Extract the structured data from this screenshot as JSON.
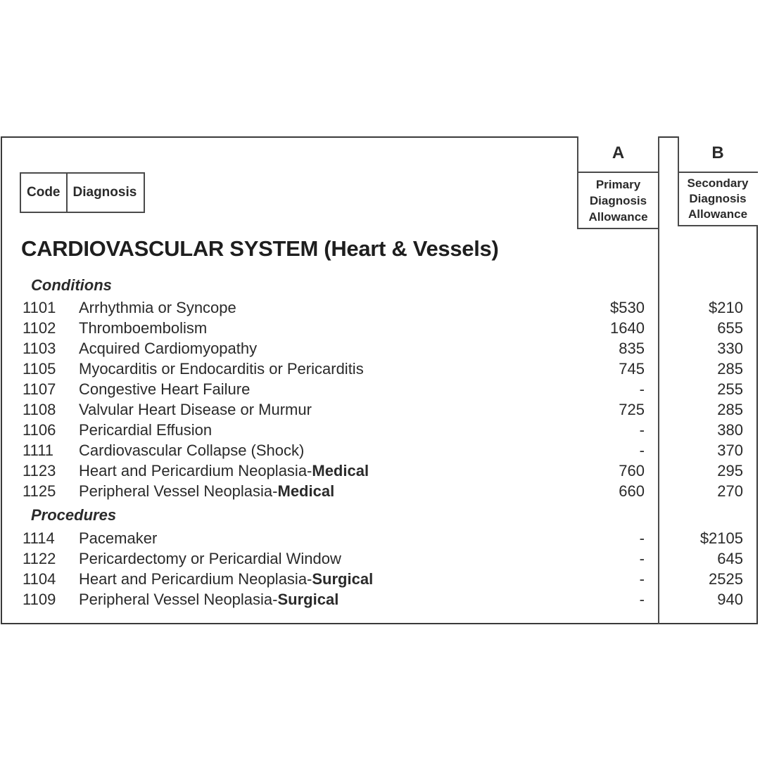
{
  "columns": {
    "code_label": "Code",
    "diagnosis_label": "Diagnosis",
    "a": {
      "letter": "A",
      "lines": [
        "Primary",
        "Diagnosis",
        "Allowance"
      ]
    },
    "b": {
      "letter": "B",
      "lines": [
        "Secondary",
        "Diagnosis",
        "Allowance"
      ]
    }
  },
  "section_title": "CARDIOVASCULAR SYSTEM (Heart & Vessels)",
  "groups": [
    {
      "heading": "Conditions",
      "rows": [
        {
          "code": "1101",
          "diagnosis": "Arrhythmia or Syncope",
          "suffix": "",
          "a": "$530",
          "b": "$210"
        },
        {
          "code": "1102",
          "diagnosis": "Thromboembolism",
          "suffix": "",
          "a": "1640",
          "b": "655"
        },
        {
          "code": "1103",
          "diagnosis": "Acquired Cardiomyopathy",
          "suffix": "",
          "a": "835",
          "b": "330"
        },
        {
          "code": "1105",
          "diagnosis": "Myocarditis or Endocarditis or Pericarditis",
          "suffix": "",
          "a": "745",
          "b": "285"
        },
        {
          "code": "1107",
          "diagnosis": "Congestive Heart Failure",
          "suffix": "",
          "a": "-",
          "b": "255"
        },
        {
          "code": "1108",
          "diagnosis": "Valvular Heart Disease or Murmur",
          "suffix": "",
          "a": "725",
          "b": "285"
        },
        {
          "code": "1106",
          "diagnosis": "Pericardial Effusion",
          "suffix": "",
          "a": "-",
          "b": "380"
        },
        {
          "code": "1111",
          "diagnosis": "Cardiovascular Collapse (Shock)",
          "suffix": "",
          "a": "-",
          "b": "370"
        },
        {
          "code": "1123",
          "diagnosis": "Heart and Pericardium Neoplasia-",
          "suffix": "Medical",
          "a": "760",
          "b": "295"
        },
        {
          "code": "1125",
          "diagnosis": "Peripheral Vessel Neoplasia-",
          "suffix": "Medical",
          "a": "660",
          "b": "270"
        }
      ]
    },
    {
      "heading": "Procedures",
      "rows": [
        {
          "code": "1114",
          "diagnosis": "Pacemaker",
          "suffix": "",
          "a": "-",
          "b": "$2105"
        },
        {
          "code": "1122",
          "diagnosis": "Pericardectomy or Pericardial Window",
          "suffix": "",
          "a": "-",
          "b": "645"
        },
        {
          "code": "1104",
          "diagnosis": "Heart and Pericardium Neoplasia-",
          "suffix": "Surgical",
          "a": "-",
          "b": "2525"
        },
        {
          "code": "1109",
          "diagnosis": "Peripheral Vessel Neoplasia-",
          "suffix": "Surgical",
          "a": "-",
          "b": "940"
        }
      ]
    }
  ]
}
